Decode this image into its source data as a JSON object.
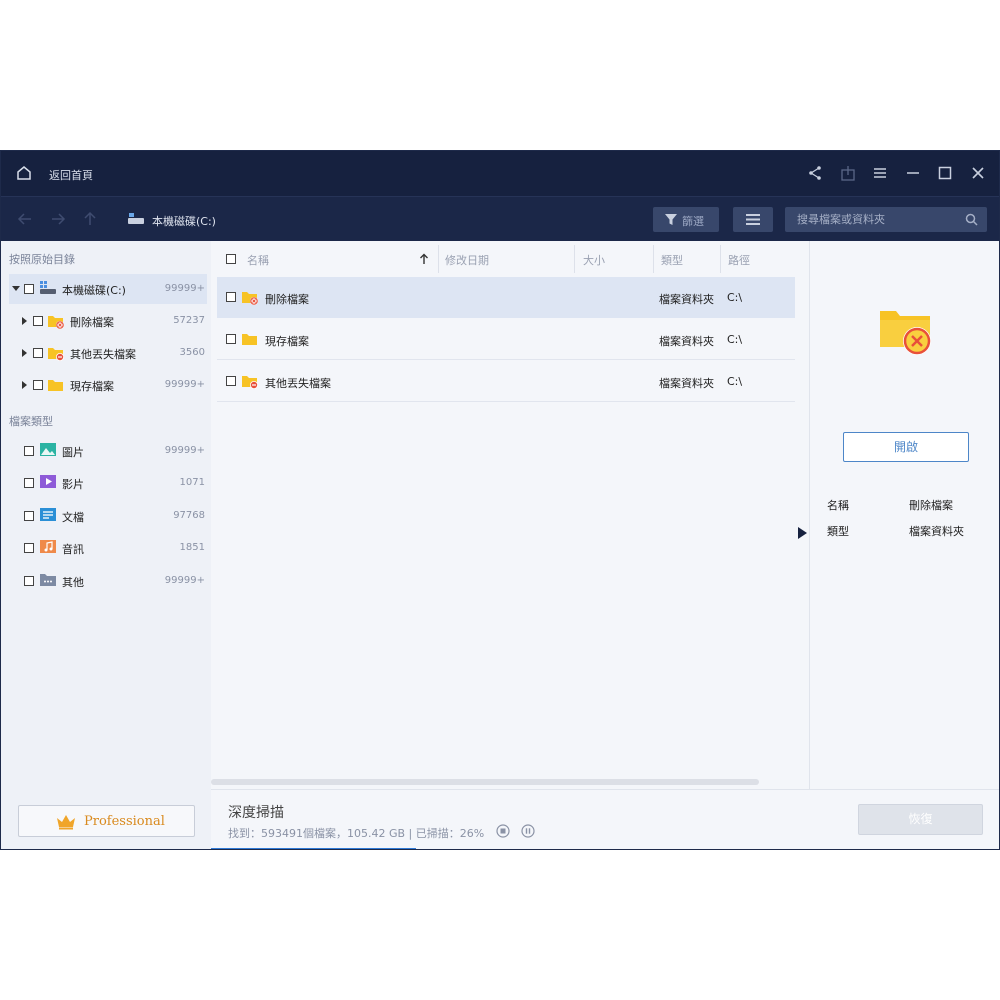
{
  "titlebar": {
    "home_label": "返回首頁"
  },
  "navbar": {
    "path": "本機磁碟(C:)",
    "filter_label": "篩選",
    "search_placeholder": "搜尋檔案或資料夾"
  },
  "sidebar": {
    "section_original": "按照原始目錄",
    "tree": [
      {
        "label": "本機磁碟(C:)",
        "count": "99999+"
      },
      {
        "label": "刪除檔案",
        "count": "57237"
      },
      {
        "label": "其他丟失檔案",
        "count": "3560"
      },
      {
        "label": "現存檔案",
        "count": "99999+"
      }
    ],
    "section_types": "檔案類型",
    "types": [
      {
        "label": "圖片",
        "count": "99999+"
      },
      {
        "label": "影片",
        "count": "1071"
      },
      {
        "label": "文檔",
        "count": "97768"
      },
      {
        "label": "音訊",
        "count": "1851"
      },
      {
        "label": "其他",
        "count": "99999+"
      }
    ],
    "pro_label": "Professional"
  },
  "table": {
    "headers": {
      "name": "名稱",
      "date": "修改日期",
      "size": "大小",
      "type": "類型",
      "path": "路徑"
    },
    "rows": [
      {
        "name": "刪除檔案",
        "type": "檔案資料夾",
        "path": "C:\\"
      },
      {
        "name": "現存檔案",
        "type": "檔案資料夾",
        "path": "C:\\"
      },
      {
        "name": "其他丟失檔案",
        "type": "檔案資料夾",
        "path": "C:\\"
      }
    ]
  },
  "details": {
    "open_label": "開啟",
    "name_key": "名稱",
    "name_val": "刪除檔案",
    "type_key": "類型",
    "type_val": "檔案資料夾"
  },
  "status": {
    "title": "深度掃描",
    "info": "找到：593491個檔案，105.42 GB | 已掃描：26%",
    "progress": 0.26,
    "recover_label": "恢復"
  },
  "colors": {
    "titlebar": "#16213f",
    "accent": "#2f7ad6",
    "folder": "#f7c325",
    "delete_badge": "#e8503a"
  }
}
